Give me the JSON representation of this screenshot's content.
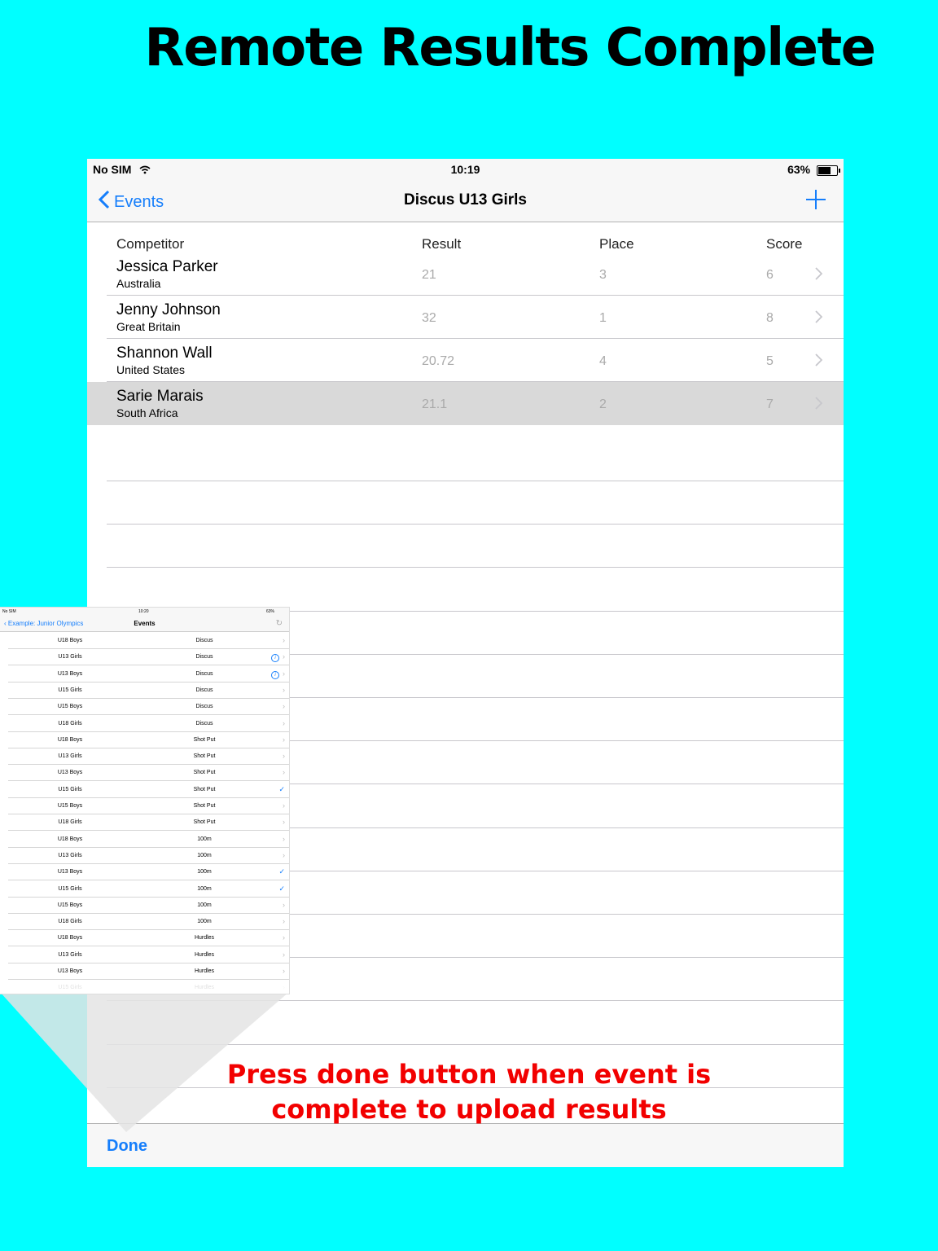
{
  "headline": "Remote Results Complete",
  "status_bar": {
    "carrier": "No SIM",
    "time": "10:19",
    "battery": "63%"
  },
  "nav": {
    "back_label": "Events",
    "title": "Discus U13 Girls"
  },
  "columns": {
    "competitor": "Competitor",
    "result": "Result",
    "place": "Place",
    "score": "Score"
  },
  "rows": [
    {
      "name": "Jessica Parker",
      "country": "Australia",
      "result": "21",
      "place": "3",
      "score": "6"
    },
    {
      "name": "Jenny Johnson",
      "country": "Great Britain",
      "result": "32",
      "place": "1",
      "score": "8"
    },
    {
      "name": "Shannon Wall",
      "country": "United States",
      "result": "20.72",
      "place": "4",
      "score": "5"
    },
    {
      "name": "Sarie Marais",
      "country": "South Africa",
      "result": "21.1",
      "place": "2",
      "score": "7"
    }
  ],
  "toolbar": {
    "done_label": "Done"
  },
  "instruction": {
    "line1": "Press done button when event is",
    "line2": "complete to upload results"
  },
  "inset": {
    "status_bar": {
      "carrier": "No SIM",
      "time": "10:20",
      "battery": "63%"
    },
    "back_label": "Example: Junior Olympics",
    "title": "Events",
    "rows": [
      {
        "group": "U18 Boys",
        "event": "Discus",
        "accessory": "chevron"
      },
      {
        "group": "U13 Girls",
        "event": "Discus",
        "accessory": "info"
      },
      {
        "group": "U13 Boys",
        "event": "Discus",
        "accessory": "info"
      },
      {
        "group": "U15 Girls",
        "event": "Discus",
        "accessory": "chevron"
      },
      {
        "group": "U15 Boys",
        "event": "Discus",
        "accessory": "chevron"
      },
      {
        "group": "U18 Girls",
        "event": "Discus",
        "accessory": "chevron"
      },
      {
        "group": "U18 Boys",
        "event": "Shot Put",
        "accessory": "chevron"
      },
      {
        "group": "U13 Girls",
        "event": "Shot Put",
        "accessory": "chevron"
      },
      {
        "group": "U13 Boys",
        "event": "Shot Put",
        "accessory": "chevron"
      },
      {
        "group": "U15 Girls",
        "event": "Shot Put",
        "accessory": "check"
      },
      {
        "group": "U15 Boys",
        "event": "Shot Put",
        "accessory": "chevron"
      },
      {
        "group": "U18 Girls",
        "event": "Shot Put",
        "accessory": "chevron"
      },
      {
        "group": "U18 Boys",
        "event": "100m",
        "accessory": "chevron"
      },
      {
        "group": "U13 Girls",
        "event": "100m",
        "accessory": "chevron"
      },
      {
        "group": "U13 Boys",
        "event": "100m",
        "accessory": "check"
      },
      {
        "group": "U15 Girls",
        "event": "100m",
        "accessory": "check"
      },
      {
        "group": "U15 Boys",
        "event": "100m",
        "accessory": "chevron"
      },
      {
        "group": "U18 Girls",
        "event": "100m",
        "accessory": "chevron"
      },
      {
        "group": "U18 Boys",
        "event": "Hurdles",
        "accessory": "chevron"
      },
      {
        "group": "U13 Girls",
        "event": "Hurdles",
        "accessory": "chevron"
      },
      {
        "group": "U13 Boys",
        "event": "Hurdles",
        "accessory": "chevron"
      },
      {
        "group": "U15 Girls",
        "event": "Hurdles",
        "accessory": "chevron"
      }
    ]
  },
  "colors": {
    "background": "#00ffff",
    "accent": "#157efb",
    "instruction": "#f20000"
  }
}
